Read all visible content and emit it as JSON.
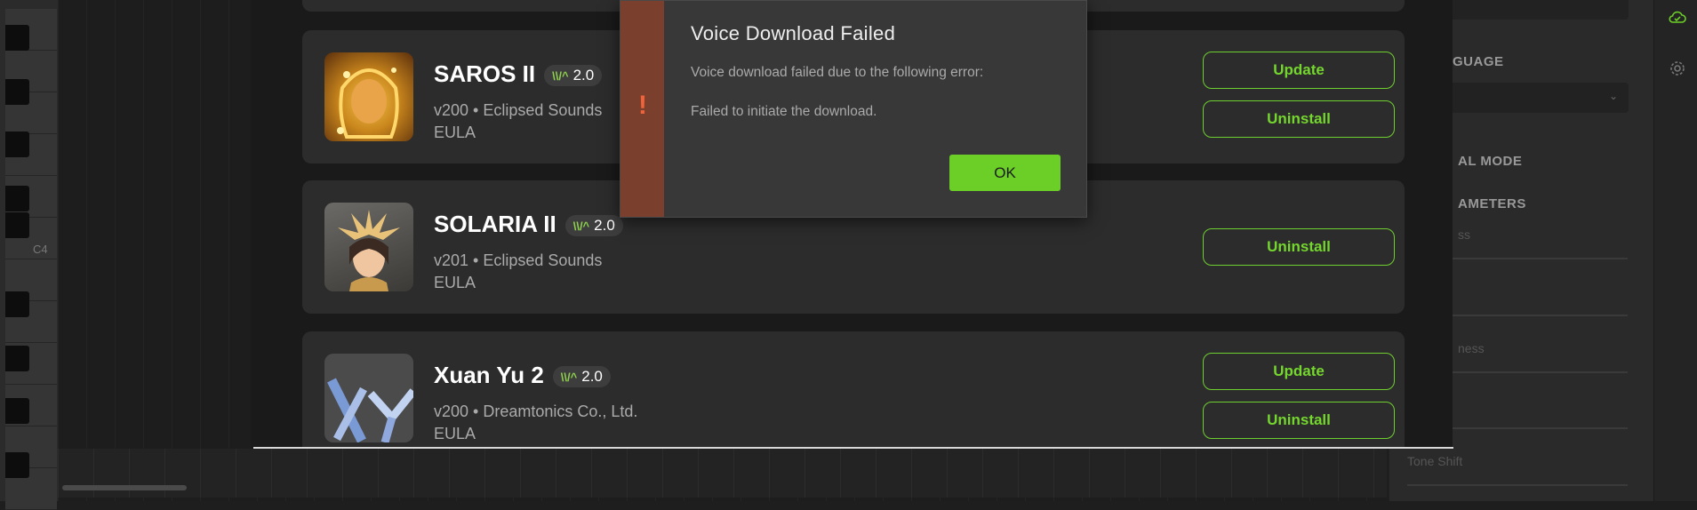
{
  "piano": {
    "c4_label": "C4"
  },
  "voices": [
    {
      "name": "SAROS II",
      "badge": "2.0",
      "badge_icon": "waveform-icon",
      "meta": "v200 • Eclipsed Sounds",
      "eula": "EULA",
      "buttons": [
        "Update",
        "Uninstall"
      ]
    },
    {
      "name": "SOLARIA II",
      "badge": "2.0",
      "badge_icon": "waveform-icon",
      "meta": "v201 • Eclipsed Sounds",
      "eula": "EULA",
      "buttons": [
        "Uninstall"
      ]
    },
    {
      "name": "Xuan Yu 2",
      "badge": "2.0",
      "badge_icon": "waveform-icon",
      "meta": "v200 • Dreamtonics Co., Ltd.",
      "eula": "EULA",
      "buttons": [
        "Update",
        "Uninstall"
      ]
    }
  ],
  "dialog": {
    "title": "Voice Download Failed",
    "message": "Voice download failed due to the following error:",
    "detail": "Failed to initiate the download.",
    "ok_label": "OK",
    "icon": "exclamation-icon",
    "icon_glyph": "!"
  },
  "right_panel": {
    "language_label": "GUAGE",
    "mode_label": "AL MODE",
    "params_label": "AMETERS",
    "field1": "ss",
    "field2": "ness",
    "field3": "Tone Shift"
  },
  "colors": {
    "accent": "#6ccf27",
    "error_stripe": "#7a3f2d",
    "error_icon": "#f0623a"
  }
}
